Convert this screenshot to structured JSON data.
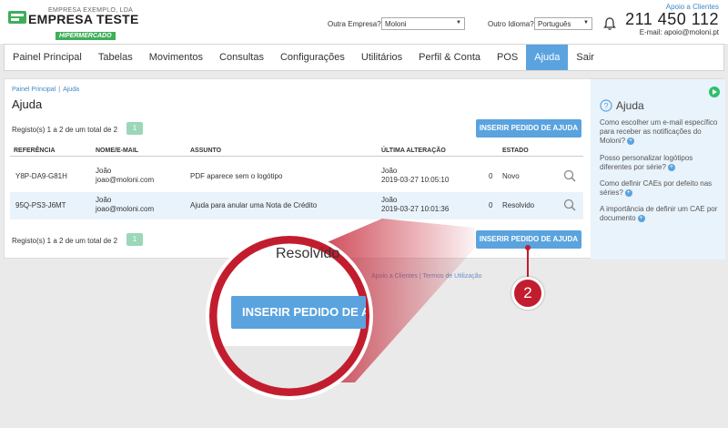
{
  "header": {
    "company_small": "EMPRESA EXEMPLO, LDA",
    "company_name": "EMPRESA TESTE",
    "company_tag": "HIPERMERCADO",
    "other_company_label": "Outra Empresa?",
    "other_company_value": "Moloni",
    "other_language_label": "Outro Idioma?",
    "other_language_value": "Português",
    "support_link": "Apoio a Clientes",
    "phone": "211 450 112",
    "email": "E-mail: apoio@moloni.pt"
  },
  "nav": {
    "items": [
      "Painel Principal",
      "Tabelas",
      "Movimentos",
      "Consultas",
      "Configurações",
      "Utilitários",
      "Perfil & Conta",
      "POS",
      "Ajuda",
      "Sair"
    ],
    "active": "Ajuda"
  },
  "main": {
    "breadcrumb": [
      "Painel Principal",
      "Ajuda"
    ],
    "title": "Ajuda",
    "records_text": "Registo(s) 1 a 2 de um total de 2",
    "page": "1",
    "insert_button": "INSERIR PEDIDO DE AJUDA",
    "columns": [
      "REFERÊNCIA",
      "NOME/E-MAIL",
      "ASSUNTO",
      "ÚLTIMA ALTERAÇÃO",
      "ESTADO"
    ],
    "rows": [
      {
        "ref": "Y8P-DA9-G81H",
        "name": "João",
        "email": "joao@moloni.com",
        "subject": "PDF aparece sem o logótipo",
        "changed_by": "João",
        "changed_at": "2019-03-27 10:05:10",
        "count": "0",
        "status": "Novo"
      },
      {
        "ref": "95Q-PS3-J6MT",
        "name": "João",
        "email": "joao@moloni.com",
        "subject": "Ajuda para anular uma Nota de Crédito",
        "changed_by": "João",
        "changed_at": "2019-03-27 10:01:36",
        "count": "0",
        "status": "Resolvido"
      }
    ]
  },
  "side": {
    "title": "Ajuda",
    "faqs": [
      "Como escolher um e-mail específico para receber as notificações do Moloni?",
      "Posso personalizar logótipos diferentes por série?",
      "Como definir CAEs por defeito nas séries?",
      "A importância de definir um CAE por documento"
    ]
  },
  "footer": {
    "fragment": "Apoio a Clientes | Termos de Utilização"
  },
  "annotation": {
    "zoom_status": "Resolvido",
    "zoom_button": "INSERIR PEDIDO DE AJUDA",
    "step": "2",
    "accent": "#c21d2e"
  }
}
